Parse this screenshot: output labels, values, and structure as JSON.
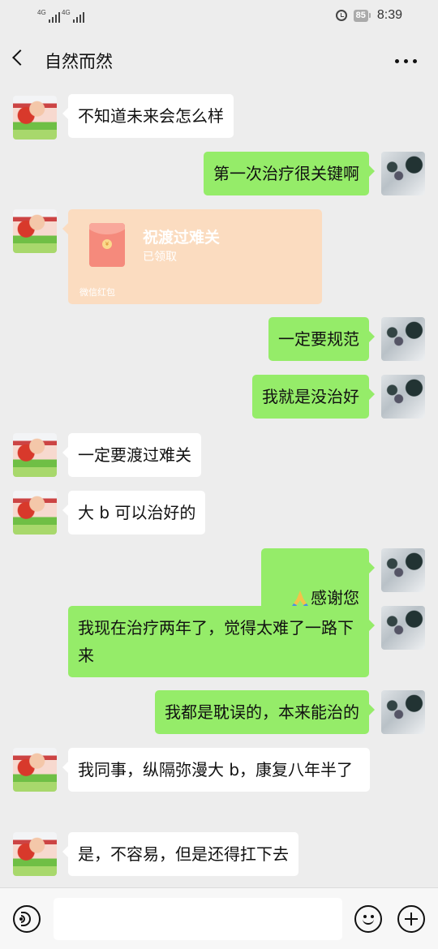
{
  "status_bar": {
    "signal_1_label": "4G",
    "signal_2_label": "4G",
    "battery": "85",
    "time": "8:39",
    "icons": [
      "signal-icon",
      "signal-icon",
      "alarm-icon",
      "battery-icon"
    ]
  },
  "header": {
    "title": "自然而然",
    "back_icon": "chevron-left-icon",
    "more_icon": "more-dots-icon"
  },
  "messages": [
    {
      "side": "in",
      "text": "不知道未来会怎么样"
    },
    {
      "side": "out",
      "text": "第一次治疗很关键啊"
    },
    {
      "side": "in",
      "type": "red_packet",
      "title": "祝渡过难关",
      "status": "已领取",
      "footer": "微信红包"
    },
    {
      "side": "out",
      "text": "一定要规范"
    },
    {
      "side": "out",
      "text": "我就是没治好"
    },
    {
      "side": "in",
      "text": "一定要渡过难关"
    },
    {
      "side": "in",
      "text": "大 b 可以治好的"
    },
    {
      "side": "out",
      "emoji": "folded-hands",
      "text": "感谢您"
    },
    {
      "side": "out",
      "text": "我现在治疗两年了，觉得太难了一路下来"
    },
    {
      "side": "out",
      "text": "我都是耽误的，本来能治的"
    },
    {
      "side": "in",
      "text": "我同事，纵隔弥漫大 b，康复八年半了"
    },
    {
      "side": "in",
      "text": "是，不容易，但是还得扛下去"
    }
  ],
  "input_bar": {
    "voice_icon": "voice-icon",
    "input_value": "",
    "emoji_icon": "emoji-icon",
    "plus_icon": "plus-icon"
  },
  "colors": {
    "background": "#ededed",
    "outgoing_bubble": "#95ec69",
    "incoming_bubble": "#ffffff",
    "red_packet_received": "#fbdcc0"
  }
}
